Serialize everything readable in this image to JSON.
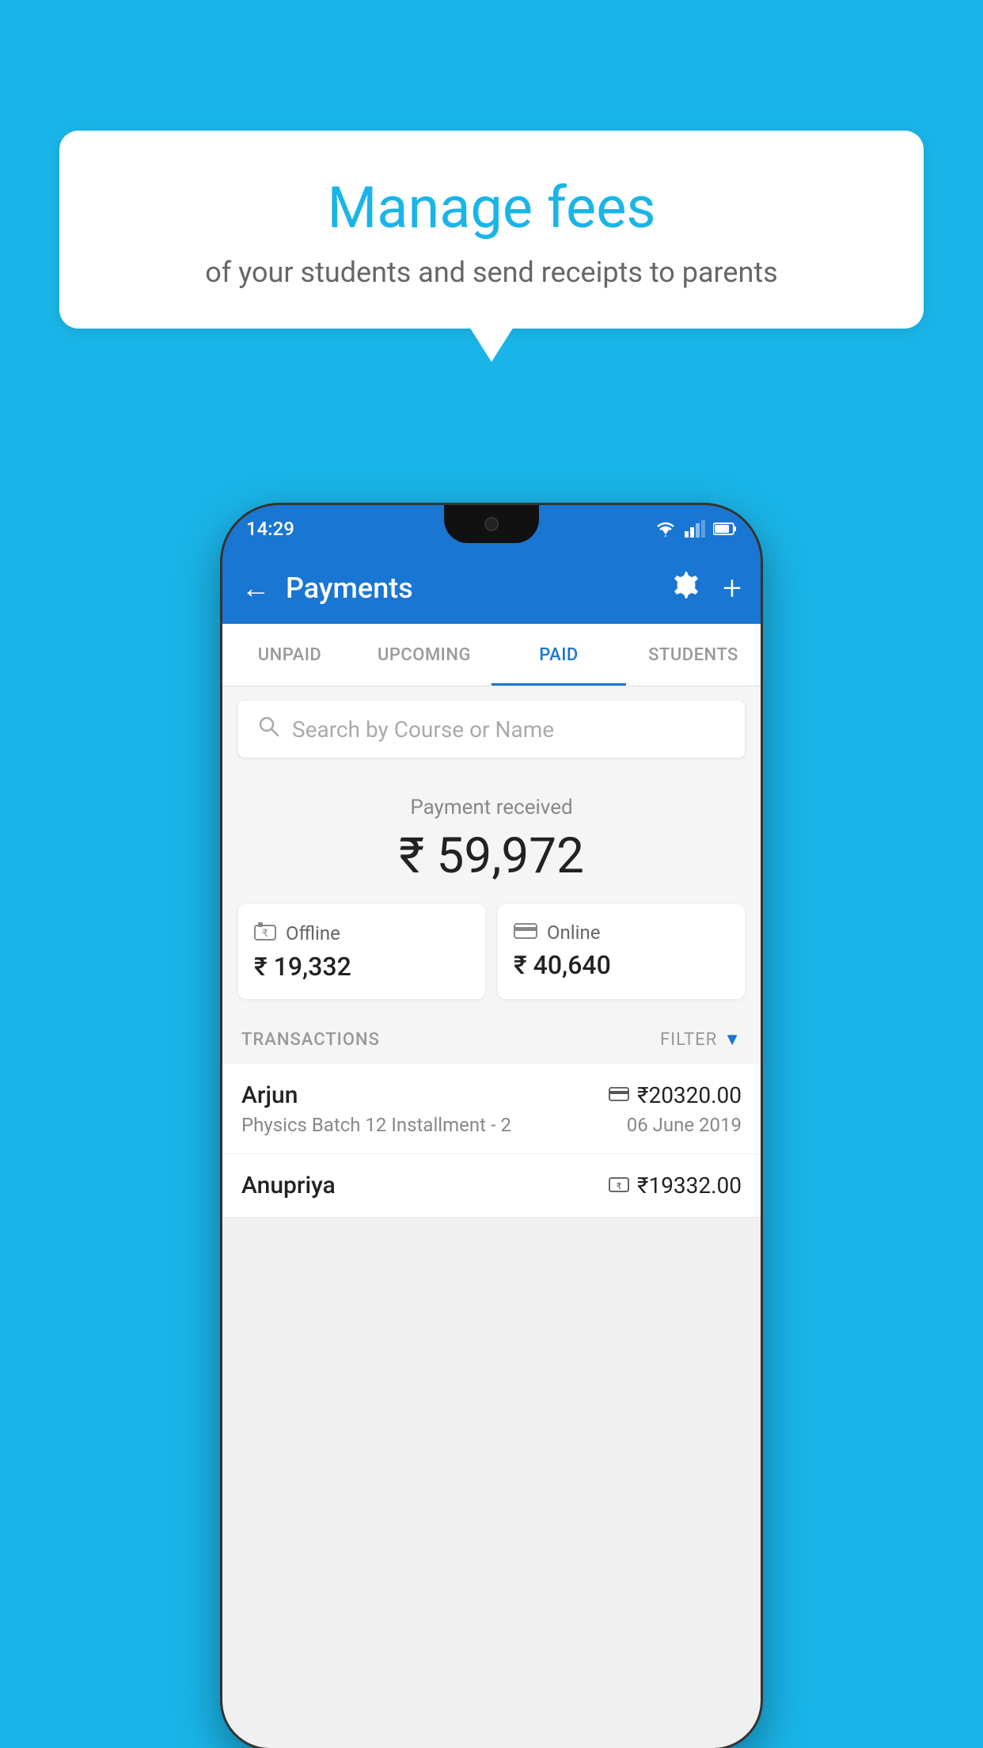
{
  "background_color": "#1ab5e8",
  "bubble": {
    "title": "Manage fees",
    "subtitle": "of your students and send receipts to parents"
  },
  "phone": {
    "status_bar": {
      "time": "14:29"
    },
    "app_bar": {
      "title": "Payments",
      "back_label": "←",
      "settings_label": "⚙",
      "add_label": "+"
    },
    "tabs": [
      {
        "label": "UNPAID",
        "active": false
      },
      {
        "label": "UPCOMING",
        "active": false
      },
      {
        "label": "PAID",
        "active": true
      },
      {
        "label": "STUDENTS",
        "active": false
      }
    ],
    "search": {
      "placeholder": "Search by Course or Name"
    },
    "payment_summary": {
      "label": "Payment received",
      "amount": "₹ 59,972",
      "offline": {
        "label": "Offline",
        "amount": "₹ 19,332"
      },
      "online": {
        "label": "Online",
        "amount": "₹ 40,640"
      }
    },
    "transactions_header": {
      "label": "TRANSACTIONS",
      "filter_label": "FILTER"
    },
    "transactions": [
      {
        "name": "Arjun",
        "amount": "₹20320.00",
        "course": "Physics Batch 12 Installment - 2",
        "date": "06 June 2019",
        "payment_type": "card"
      },
      {
        "name": "Anupriya",
        "amount": "₹19332.00",
        "course": "",
        "date": "",
        "payment_type": "offline"
      }
    ]
  }
}
